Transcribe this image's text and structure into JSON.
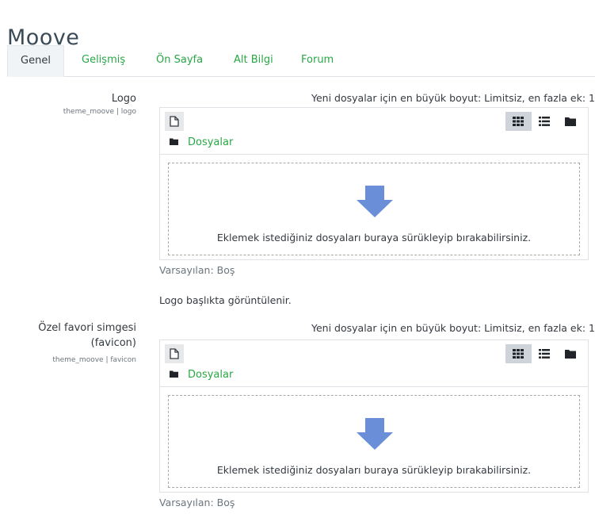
{
  "page": {
    "title": "Moove"
  },
  "tabs": [
    {
      "label": "Genel",
      "active": true
    },
    {
      "label": "Gelişmiş",
      "active": false
    },
    {
      "label": "Ön Sayfa",
      "active": false
    },
    {
      "label": "Alt Bilgi",
      "active": false
    },
    {
      "label": "Forum",
      "active": false
    }
  ],
  "settings": [
    {
      "label": "Logo",
      "sublabel": "theme_moove | logo",
      "limit_text": "Yeni dosyalar için en büyük boyut: Limitsiz, en fazla ek: 1",
      "path_label": "Dosyalar",
      "drop_text": "Eklemek istediğiniz dosyaları buraya sürükleyip bırakabilirsiniz.",
      "default_text": "Varsayılan: Boş",
      "description": "Logo başlıkta görüntülenir."
    },
    {
      "label_line1": "Özel favori simgesi",
      "label_line2": "(favicon)",
      "sublabel": "theme_moove | favicon",
      "limit_text": "Yeni dosyalar için en büyük boyut: Limitsiz, en fazla ek: 1",
      "path_label": "Dosyalar",
      "drop_text": "Eklemek istediğiniz dosyaları buraya sürükleyip bırakabilirsiniz.",
      "default_text": "Varsayılan: Boş"
    }
  ],
  "icons": {
    "add_file": "file-icon",
    "view_icons": "grid-icon",
    "view_list": "list-icon",
    "view_tree": "folder-icon",
    "path_folder": "folder-icon",
    "drop_arrow": "arrow-down-icon"
  },
  "colors": {
    "accent": "#28a745",
    "arrow": "#6a8fd8"
  }
}
